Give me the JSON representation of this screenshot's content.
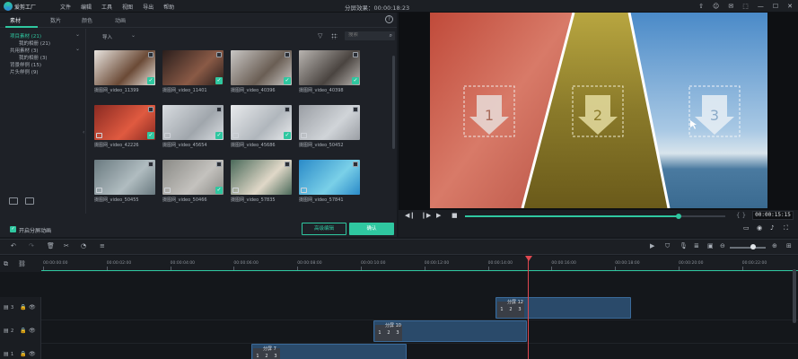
{
  "app": {
    "logo_text": "爱剪工厂",
    "menu": [
      "文件",
      "编辑",
      "工具",
      "视图",
      "导出",
      "帮助"
    ],
    "window_title": "分屏效果：00:00:18:23",
    "window_controls": [
      "⇧",
      "☺",
      "✉",
      "⬚",
      "—",
      "☐",
      "✕"
    ]
  },
  "library": {
    "tabs": [
      "素材",
      "数片",
      "颜色",
      "动画"
    ],
    "active_tab": 0,
    "help": "?",
    "tree": [
      {
        "label": "项目素材 (21)",
        "selected": true,
        "expandable": true
      },
      {
        "label": "我的相册 (21)",
        "selected": false,
        "expandable": false
      },
      {
        "label": "共用素材 (3)",
        "selected": false,
        "expandable": true
      },
      {
        "label": "我的相册 (3)",
        "selected": false,
        "expandable": false
      },
      {
        "label": "背景样例 (15)",
        "selected": false,
        "expandable": false
      },
      {
        "label": "片头样例 (9)",
        "selected": false,
        "expandable": false
      }
    ],
    "sort_label": "导入",
    "search_placeholder": "搜索",
    "items": [
      {
        "label": "摄图网_video_11399",
        "checked": true,
        "video": false,
        "c1": "#e8e4df",
        "c2": "#6b4a36"
      },
      {
        "label": "摄图网_video_11401",
        "checked": true,
        "video": false,
        "c1": "#2a1e1c",
        "c2": "#8a5a46"
      },
      {
        "label": "摄图网_video_40396",
        "checked": true,
        "video": false,
        "c1": "#c8c6c4",
        "c2": "#6a5e54"
      },
      {
        "label": "摄图网_video_40398",
        "checked": true,
        "video": false,
        "c1": "#b8b4b0",
        "c2": "#4a4440"
      },
      {
        "label": "摄图网_video_42226",
        "checked": true,
        "video": true,
        "c1": "#8a2a22",
        "c2": "#e05a40"
      },
      {
        "label": "摄图网_video_45654",
        "checked": true,
        "video": true,
        "c1": "#d8dce0",
        "c2": "#a0a6ac"
      },
      {
        "label": "摄图网_video_45686",
        "checked": true,
        "video": true,
        "c1": "#e8eaec",
        "c2": "#b0b6bc"
      },
      {
        "label": "摄图网_video_50452",
        "checked": false,
        "video": true,
        "c1": "#9a9ea4",
        "c2": "#d0d4d8"
      },
      {
        "label": "摄图网_video_50455",
        "checked": false,
        "video": true,
        "c1": "#6a7a80",
        "c2": "#b0bcc0"
      },
      {
        "label": "摄图网_video_50466",
        "checked": true,
        "video": true,
        "c1": "#8a8a86",
        "c2": "#c4c2be"
      },
      {
        "label": "摄图网_video_57835",
        "checked": false,
        "video": true,
        "c1": "#4a6a5a",
        "c2": "#e0d8c8"
      },
      {
        "label": "摄图网_video_57841",
        "checked": false,
        "video": true,
        "c1": "#2a8ac8",
        "c2": "#7ad0e8"
      }
    ],
    "footer": {
      "checkbox_label": "开启分屏动画",
      "advanced_button": "高级编辑",
      "ok_button": "确认"
    }
  },
  "preview": {
    "zones": [
      "1",
      "2",
      "3"
    ],
    "progress": 0.82,
    "timecode": "00:00:15:15",
    "braces": "{ }"
  },
  "timeline": {
    "ruler_labels": [
      "00:00:00:00",
      "00:00:02:00",
      "00:00:04:00",
      "00:00:06:00",
      "00:00:08:00",
      "00:00:10:00",
      "00:00:12:00",
      "00:00:14:00",
      "00:00:16:00",
      "00:00:18:00",
      "00:00:20:00",
      "00:00:22:00"
    ],
    "tracks": [
      {
        "num": "3"
      },
      {
        "num": "2"
      },
      {
        "num": "1"
      }
    ],
    "clips": [
      {
        "title": "分屏 12",
        "zones": [
          "1",
          "2",
          "3"
        ]
      },
      {
        "title": "分屏 10",
        "zones": [
          "1",
          "2",
          "3"
        ]
      },
      {
        "title": "分屏 7",
        "zones": [
          "1",
          "2",
          "3"
        ]
      }
    ]
  },
  "colors": {
    "accent": "#2fc7a0",
    "playhead": "#e04850",
    "clip": "#2a4a6a"
  }
}
